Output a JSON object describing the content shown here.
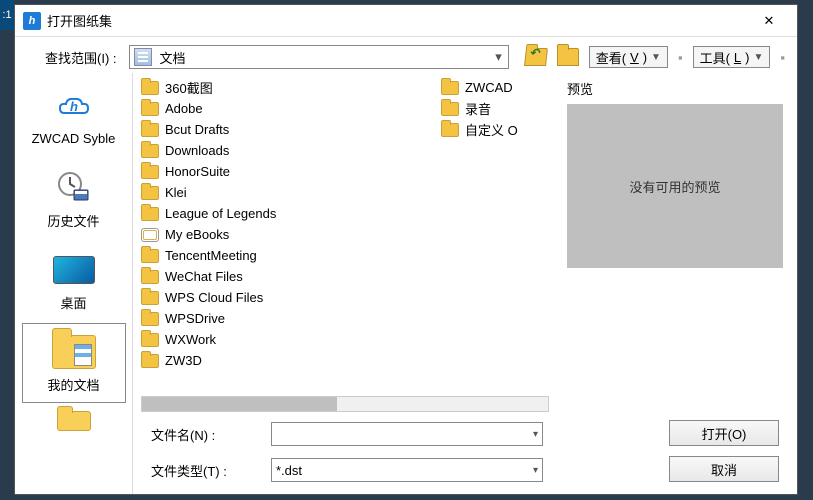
{
  "titlebar": {
    "title": "打开图纸集"
  },
  "toprow": {
    "look_in_label": "查找范围(I) :",
    "look_in_value": "文档",
    "view_label_pre": "查看(",
    "view_label_key": "V",
    "view_label_post": ")",
    "tools_label_pre": "工具(",
    "tools_label_key": "L",
    "tools_label_post": ")"
  },
  "sidebar": {
    "items": [
      {
        "label": "ZWCAD Syble"
      },
      {
        "label": "历史文件"
      },
      {
        "label": "桌面"
      },
      {
        "label": "我的文档"
      }
    ]
  },
  "files_col1": [
    {
      "name": "360截图",
      "kind": "folder"
    },
    {
      "name": "Adobe",
      "kind": "folder"
    },
    {
      "name": "Bcut Drafts",
      "kind": "folder"
    },
    {
      "name": "Downloads",
      "kind": "folder"
    },
    {
      "name": "HonorSuite",
      "kind": "folder"
    },
    {
      "name": "Klei",
      "kind": "folder"
    },
    {
      "name": "League of Legends",
      "kind": "folder"
    },
    {
      "name": "My eBooks",
      "kind": "ebook"
    },
    {
      "name": "TencentMeeting",
      "kind": "folder"
    },
    {
      "name": "WeChat Files",
      "kind": "folder"
    },
    {
      "name": "WPS Cloud Files",
      "kind": "folder"
    },
    {
      "name": "WPSDrive",
      "kind": "folder"
    },
    {
      "name": "WXWork",
      "kind": "folder"
    },
    {
      "name": "ZW3D",
      "kind": "folder"
    }
  ],
  "files_col2": [
    {
      "name": "ZWCAD",
      "kind": "folder"
    },
    {
      "name": "录音",
      "kind": "folder"
    },
    {
      "name": "自定义 O",
      "kind": "folder"
    }
  ],
  "preview": {
    "label": "预览",
    "placeholder": "没有可用的预览"
  },
  "bottom": {
    "filename_label": "文件名(N) :",
    "filename_value": "",
    "filetype_label": "文件类型(T) :",
    "filetype_value": "*.dst",
    "open_btn": "打开(O)",
    "cancel_btn": "取消"
  }
}
